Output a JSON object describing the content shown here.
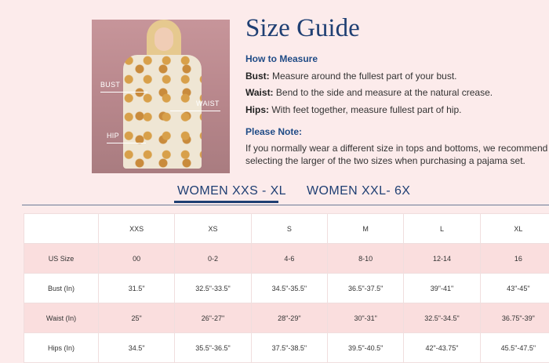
{
  "title": "Size Guide",
  "photo": {
    "labels": {
      "bust": "BUST",
      "waist": "WAIST",
      "hip": "HIP"
    }
  },
  "how_to_measure": {
    "heading": "How to Measure",
    "items": [
      {
        "term": "Bust:",
        "text": "Measure around the fullest part of your bust."
      },
      {
        "term": "Waist:",
        "text": "Bend to the side and measure at the natural crease."
      },
      {
        "term": "Hips:",
        "text": "With feet together, measure fullest part of hip."
      }
    ]
  },
  "note": {
    "heading": "Please Note:",
    "line1": "If you normally wear a different size in tops and bottoms, we recommend",
    "line2": "selecting the larger of the two sizes when purchasing a pajama set."
  },
  "tabs": [
    "WOMEN XXS - XL",
    "WOMEN XXL- 6X"
  ],
  "table": {
    "columns": [
      "",
      "XXS",
      "XS",
      "S",
      "M",
      "L",
      "XL"
    ],
    "rows": [
      {
        "label": "US Size",
        "values": [
          "00",
          "0-2",
          "4-6",
          "8-10",
          "12-14",
          "16"
        ]
      },
      {
        "label": "Bust (In)",
        "values": [
          "31.5\"",
          "32.5\"-33.5\"",
          "34.5\"-35.5\"",
          "36.5\"-37.5\"",
          "39\"-41\"",
          "43\"-45\""
        ]
      },
      {
        "label": "Waist (In)",
        "values": [
          "25\"",
          "26\"-27\"",
          "28\"-29\"",
          "30\"-31\"",
          "32.5\"-34.5\"",
          "36.75\"-39\""
        ]
      },
      {
        "label": "Hips (In)",
        "values": [
          "34.5\"",
          "35.5\"-36.5\"",
          "37.5\"-38.5\"",
          "39.5\"-40.5\"",
          "42\"-43.75\"",
          "45.5\"-47.5\""
        ]
      }
    ]
  }
}
